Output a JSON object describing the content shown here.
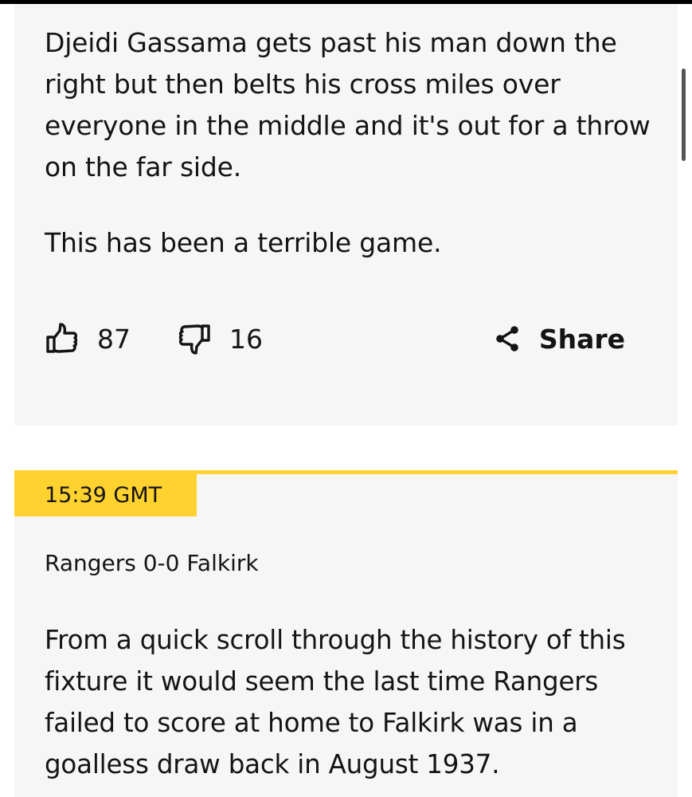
{
  "posts": [
    {
      "paragraphs": [
        "Djeidi Gassama gets past his man down the right but then belts his cross miles over everyone in the middle and it's out for a throw on the far side.",
        "This has been a terrible game."
      ],
      "likes": "87",
      "dislikes": "16",
      "share_label": "Share"
    },
    {
      "time": "15:39 GMT",
      "subtitle": "Rangers 0-0 Falkirk",
      "paragraphs": [
        "From a quick scroll through the history of this fixture it would seem the last time Rangers failed to score at home to Falkirk was in a goalless draw back in August 1937."
      ]
    }
  ],
  "colors": {
    "accent": "#ffd230",
    "card_background": "#f6f6f6",
    "text": "#141414"
  },
  "icons": {
    "like": "thumbs-up-icon",
    "dislike": "thumbs-down-icon",
    "share": "share-icon"
  }
}
